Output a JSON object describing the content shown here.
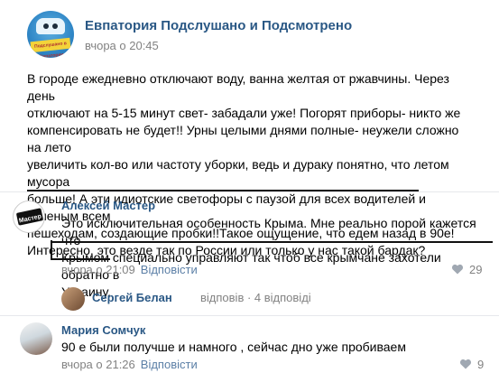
{
  "post": {
    "group_name": "Евпатория Подслушано и Подсмотрено",
    "timestamp": "вчора о 20:45",
    "avatar_text": "Подслушано в Евпатории",
    "body_lines": [
      "В городе ежедневно отключают воду, ванна желтая от ржавчины. Через день",
      "отключают на 5-15 минут свет- забадали уже! Погорят приборы- никто же",
      "компенсировать не будет!! Урны целыми днями полные- неужели сложно на лето",
      "увеличить кол-во или частоту уборки, ведь и дураку понятно, что летом мусора",
      "больше! А эти идиотские светофоры с паузой для всех водителей и зеленым всем",
      "пешеходам, создающие пробки!!Такое ощущение, что едем назад в 90е!",
      "Интересно, это везде так по России или только у нас такой бардак?"
    ]
  },
  "comments": [
    {
      "author": "Алексей Мастер",
      "avatar_text": "Mастер",
      "text_lines": [
        "Это исключительная особенность Крыма. Мне реально порой кажется что",
        "Крымом специально управляют так чтоб все крымчане захотели обратно в",
        "Украину."
      ],
      "time": "вчора о 21:09",
      "reply_label": "Відповісти",
      "likes": "29"
    },
    {
      "author": "Мария Сомчук",
      "text_lines": [
        "90 е были получше и намного , сейчас дно уже пробиваем"
      ],
      "time": "вчора о 21:26",
      "reply_label": "Відповісти",
      "likes": "9"
    }
  ],
  "sub_reply": {
    "author": "Сергей Белан",
    "action": "відповів · 4 відповіді"
  }
}
